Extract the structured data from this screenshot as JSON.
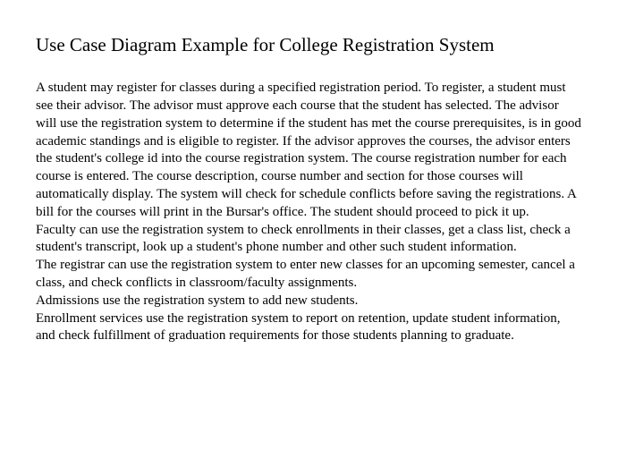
{
  "document": {
    "title": "Use Case Diagram Example for College Registration System",
    "paragraphs": {
      "p1": "A student may register for classes during a specified registration period. To register, a student must see their advisor. The advisor must approve each course that the student has selected. The advisor will use the registration system to determine if the student has met the course prerequisites, is in good academic standings and is eligible to register. If the advisor approves the courses, the advisor enters the student's college id into the course registration system. The course registration number for each course is entered. The course description, course number and section for those courses will automatically display. The system will check for schedule conflicts before saving the registrations. A bill for the courses will print in the Bursar's office. The student should proceed to pick it up.",
      "p2": "Faculty can use the registration system to check enrollments in their classes, get a class list, check a student's transcript, look up a student's phone number and other such student information.",
      "p3": "The registrar can use the registration system to enter new classes for an upcoming semester, cancel a class, and check conflicts in classroom/faculty assignments.",
      "p4": "Admissions use the registration system to add new students.",
      "p5": "Enrollment services use the registration system to report on retention, update student information, and check fulfillment of graduation requirements for those students planning to graduate."
    }
  }
}
